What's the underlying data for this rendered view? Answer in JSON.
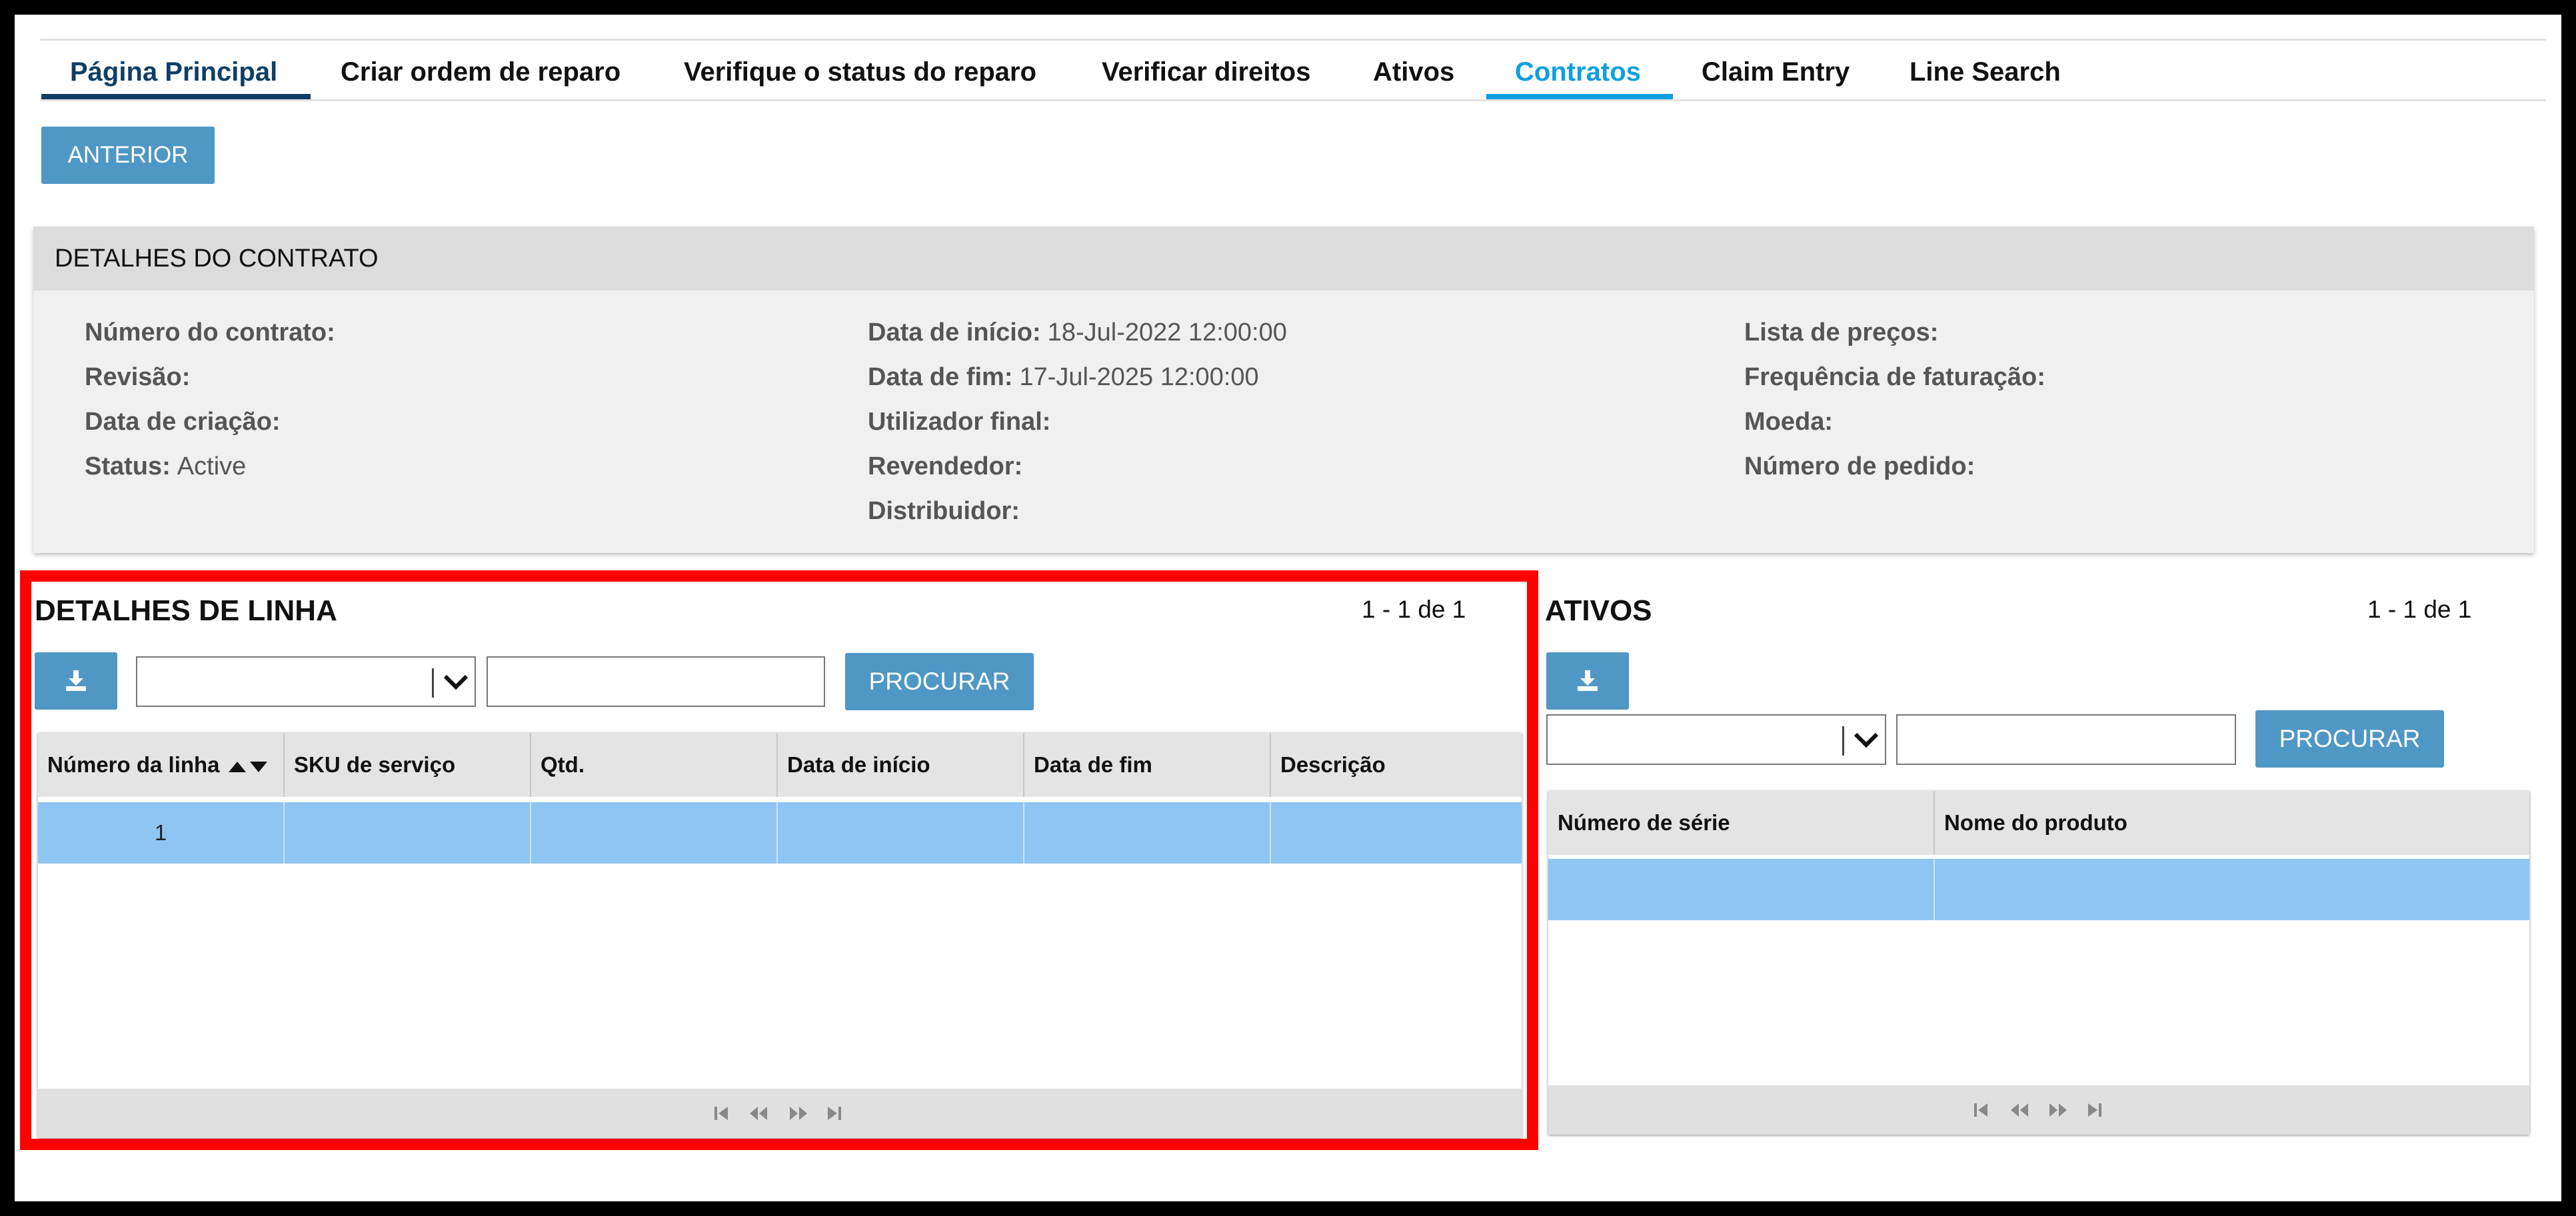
{
  "nav": {
    "tabs": [
      {
        "label": "Página Principal"
      },
      {
        "label": "Criar ordem de reparo"
      },
      {
        "label": "Verifique o status do reparo"
      },
      {
        "label": "Verificar direitos"
      },
      {
        "label": "Ativos"
      },
      {
        "label": "Contratos"
      },
      {
        "label": "Claim Entry"
      },
      {
        "label": "Line Search"
      }
    ],
    "active_tab": "Contratos"
  },
  "toolbar": {
    "back_label": "ANTERIOR"
  },
  "contract": {
    "title": "DETALHES DO CONTRATO",
    "col1": [
      {
        "label": "Número do contrato:",
        "value": ""
      },
      {
        "label": "Revisão:",
        "value": ""
      },
      {
        "label": "Data de criação:",
        "value": ""
      },
      {
        "label": "Status:",
        "value": "Active"
      }
    ],
    "col2": [
      {
        "label": "Data de início:",
        "value": "18-Jul-2022 12:00:00"
      },
      {
        "label": "Data de fim:",
        "value": "17-Jul-2025 12:00:00"
      },
      {
        "label": "Utilizador final:",
        "value": ""
      },
      {
        "label": "Revendedor:",
        "value": ""
      },
      {
        "label": "Distribuidor:",
        "value": ""
      }
    ],
    "col3": [
      {
        "label": "Lista de preços:",
        "value": ""
      },
      {
        "label": "Frequência de faturação:",
        "value": ""
      },
      {
        "label": "Moeda:",
        "value": ""
      },
      {
        "label": "Número de pedido:",
        "value": ""
      }
    ]
  },
  "line_details": {
    "title": "DETALHES DE LINHA",
    "count": "1 - 1 de 1",
    "search_label": "PROCURAR",
    "select_value": "",
    "search_value": "",
    "columns": [
      "Número da linha",
      "SKU de serviço",
      "Qtd.",
      "Data de início",
      "Data de fim",
      "Descrição"
    ],
    "rows": [
      [
        "1",
        "",
        "",
        "",
        "",
        ""
      ]
    ]
  },
  "assets": {
    "title": "ATIVOS",
    "count": "1 - 1 de 1",
    "search_label": "PROCURAR",
    "select_value": "",
    "search_value": "",
    "columns": [
      "Número de série",
      "Nome do produto"
    ],
    "rows": [
      [
        "",
        ""
      ]
    ]
  },
  "icons": {
    "download": "download-icon",
    "sort": "sort-asc-desc-icon",
    "pager": [
      "first-page-icon",
      "prev-page-icon",
      "next-page-icon",
      "last-page-icon"
    ]
  },
  "colors": {
    "accent": "#4f97c5",
    "active_tab": "#0d9fe0",
    "home_tab": "#0f3f66",
    "selected_row": "#8ec5f3",
    "highlight": "#ff0000"
  }
}
